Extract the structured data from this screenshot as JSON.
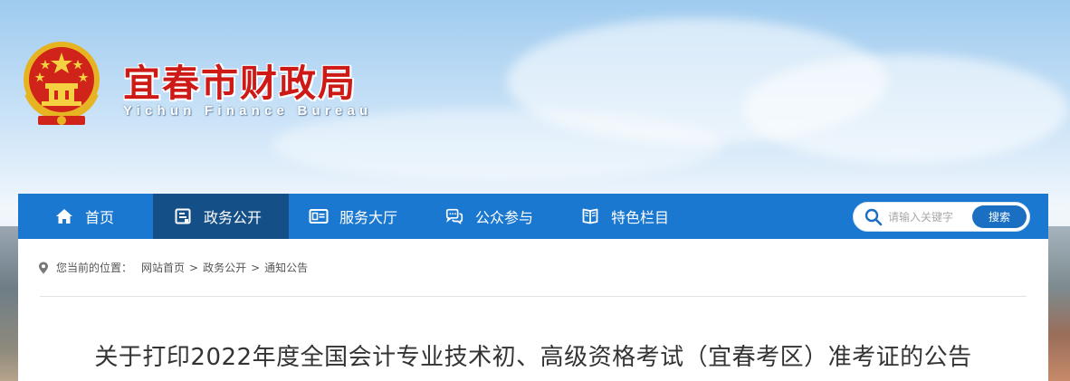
{
  "header": {
    "title": "宜春市财政局",
    "subtitle": "Yichun Finance Bureau"
  },
  "nav": {
    "items": [
      {
        "label": "首页",
        "icon": "home-icon",
        "active": false
      },
      {
        "label": "政务公开",
        "icon": "document-icon",
        "active": true
      },
      {
        "label": "服务大厅",
        "icon": "service-card-icon",
        "active": false
      },
      {
        "label": "公众参与",
        "icon": "chat-bubbles-icon",
        "active": false
      },
      {
        "label": "特色栏目",
        "icon": "book-icon",
        "active": false
      }
    ]
  },
  "search": {
    "placeholder": "请输入关键字",
    "button_label": "搜索"
  },
  "breadcrumb": {
    "prefix": "您当前的位置：",
    "items": [
      "网站首页",
      "政务公开",
      "通知公告"
    ],
    "separator": ">"
  },
  "article": {
    "title": "关于打印2022年度全国会计专业技术初、高级资格考试（宜春考区）准考证的公告"
  },
  "colors": {
    "nav_bg": "#1b78d0",
    "nav_active_bg": "#154f88",
    "title_red": "#cd1a17",
    "search_button": "#1a6fc2"
  }
}
